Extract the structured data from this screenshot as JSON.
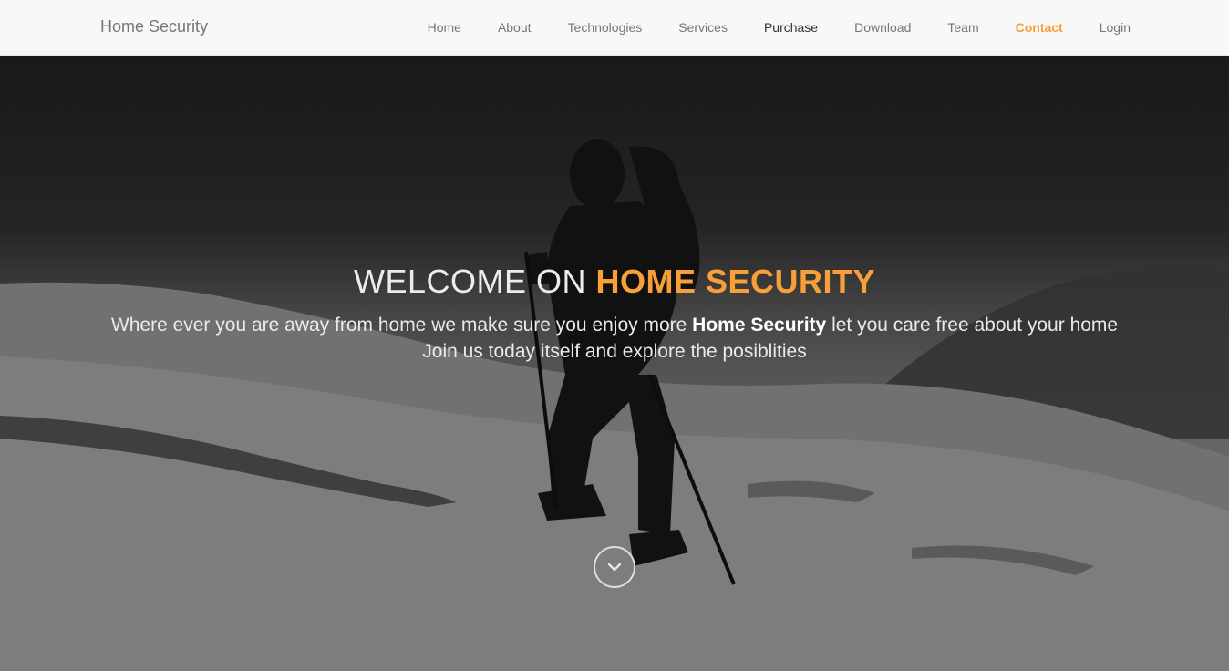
{
  "brand": "Home Security",
  "nav": {
    "items": [
      {
        "label": "Home"
      },
      {
        "label": "About"
      },
      {
        "label": "Technologies"
      },
      {
        "label": "Services"
      },
      {
        "label": "Purchase"
      },
      {
        "label": "Download"
      },
      {
        "label": "Team"
      },
      {
        "label": "Contact"
      },
      {
        "label": "Login"
      }
    ]
  },
  "hero": {
    "title_prefix": "WELCOME ON",
    "title_accent": "HOME SECURITY",
    "line1_before": "Where ever you are away from home we make sure you enjoy more",
    "line1_bold": "Home Security",
    "line1_after": "let you care free about your home",
    "line2": "Join us today itself and explore the posiblities",
    "scroll_icon": "chevron-down-icon"
  },
  "colors": {
    "accent": "#f8a037",
    "nav_bg": "#f8f8f8",
    "nav_text": "#777777"
  }
}
